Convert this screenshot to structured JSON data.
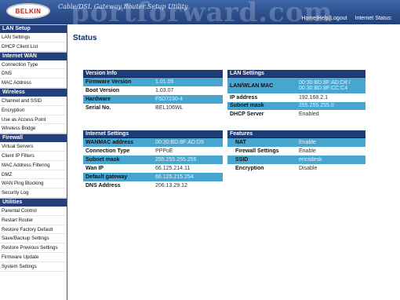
{
  "header": {
    "logo_text": "BELKIN",
    "app_title": "Cable/DSL Gateway Router Setup Utility",
    "watermark": "portforward.com",
    "links": {
      "home": "Home",
      "help": "Help",
      "logout": "Logout"
    },
    "internet_status_label": "Internet Status:"
  },
  "sidebar": {
    "sections": [
      {
        "title": "LAN Setup",
        "items": [
          "LAN Settings",
          "DHCP Client List"
        ]
      },
      {
        "title": "Internet WAN",
        "items": [
          "Connection Type",
          "DNS",
          "MAC Address"
        ]
      },
      {
        "title": "Wireless",
        "items": [
          "Channel and SSID",
          "Encryption",
          "Use as Access Point",
          "Wireless Bridge"
        ]
      },
      {
        "title": "Firewall",
        "items": [
          "Virtual Servers",
          "Client IP Filters",
          "MAC Address Filtering",
          "DMZ",
          "WAN Ping Blocking",
          "Security Log"
        ]
      },
      {
        "title": "Utilities",
        "items": [
          "Parental Control",
          "Restart Router",
          "Restore Factory Default",
          "Save/Backup Settings",
          "Restore Previous Settings",
          "Firmware Update",
          "System Settings"
        ]
      }
    ]
  },
  "main": {
    "title": "Status",
    "version_info": {
      "title": "Version Info",
      "rows": [
        {
          "label": "Firmware Version",
          "value": "1.01.05"
        },
        {
          "label": "Boot Version",
          "value": "1.03.07"
        },
        {
          "label": "Hardware",
          "value": "F5D7230-4"
        },
        {
          "label": "Serial No.",
          "value": "BEL106WL"
        }
      ]
    },
    "lan_settings": {
      "title": "LAN Settings",
      "rows": [
        {
          "label": "LAN/WLAN MAC",
          "value": "00:30:BD:8F:AD:D8 / 00:30:BD:8F:CC:C4"
        },
        {
          "label": "IP address",
          "value": "192.168.2.1"
        },
        {
          "label": "Subnet mask",
          "value": "255.255.255.0"
        },
        {
          "label": "DHCP Server",
          "value": "Enabled"
        }
      ]
    },
    "internet_settings": {
      "title": "Internet Settings",
      "rows": [
        {
          "label": "WANMAC address",
          "value": "00:30:BD:8F:AD:D9"
        },
        {
          "label": "Connection Type",
          "value": "PPPoE"
        },
        {
          "label": "Subnet mask",
          "value": "255.255.255.255"
        },
        {
          "label": "Wan IP",
          "value": "66.125.214.11"
        },
        {
          "label": "Default gateway",
          "value": "66.125.215.254"
        },
        {
          "label": "DNS Address",
          "value": "206.13.29.12"
        }
      ]
    },
    "features": {
      "title": "Features",
      "rows": [
        {
          "label": "NAT",
          "value": "Enable"
        },
        {
          "label": "Firewall Settings",
          "value": "Enable"
        },
        {
          "label": "SSID",
          "value": "ericsdesk"
        },
        {
          "label": "Encryption",
          "value": "Disable"
        }
      ]
    }
  },
  "colors": {
    "header_blue": "#2d4f8e",
    "nav_section": "#243f7a",
    "panel_header": "#1d3c78",
    "row_shade": "#46a6cf",
    "title_blue": "#0f2f66"
  }
}
